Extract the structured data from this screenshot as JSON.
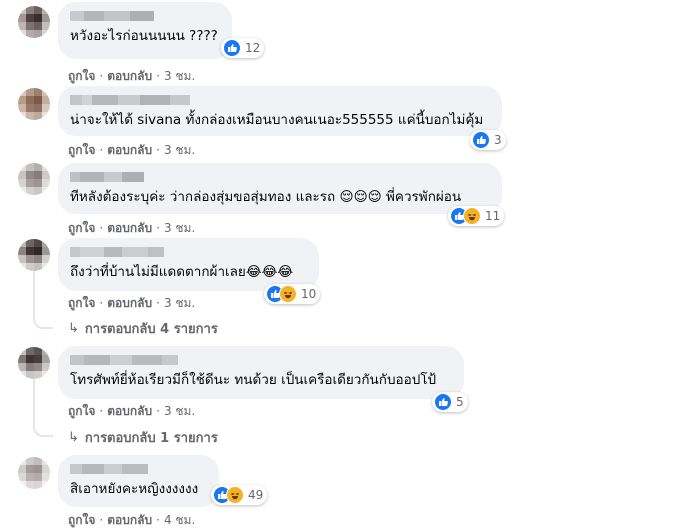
{
  "comments": [
    {
      "text": "หวังอะไรก่อนนนนน ????",
      "reaction_count": "12",
      "reactions": [
        "like-icon"
      ],
      "like_label": "ถูกใจ",
      "reply_label": "ตอบกลับ",
      "time": "3 ชม."
    },
    {
      "text": "น่าจะให้ได้ sivana ทั้งกล่องเหมือนบางคนเนอะ555555 แค่นี้บอกไม่คุ้ม",
      "reaction_count": "3",
      "reactions": [
        "like-icon"
      ],
      "like_label": "ถูกใจ",
      "reply_label": "ตอบกลับ",
      "time": "3 ชม."
    },
    {
      "text": "ทีหลังต้องระบุค่ะ ว่ากล่องสุ่มขอสุ่มทอง และรถ 😌😌😌 พี่ควรพักผ่อน",
      "reaction_count": "11",
      "reactions": [
        "like-icon",
        "haha-icon"
      ],
      "like_label": "ถูกใจ",
      "reply_label": "ตอบกลับ",
      "time": "3 ชม."
    },
    {
      "text": "ถึงว่าที่บ้านไม่มีแดดตากผ้าเลย😂😂😂",
      "reaction_count": "10",
      "reactions": [
        "like-icon",
        "haha-icon"
      ],
      "like_label": "ถูกใจ",
      "reply_label": "ตอบกลับ",
      "time": "3 ชม.",
      "view_replies": "การตอบกลับ 4 รายการ"
    },
    {
      "text": "โทรศัพท์ยี่ห้อเรียวมีก็ใช้ดีนะ ทนด้วย เป็นเครือเดียวกันกับออปโป้",
      "reaction_count": "5",
      "reactions": [
        "like-icon"
      ],
      "like_label": "ถูกใจ",
      "reply_label": "ตอบกลับ",
      "time": "3 ชม.",
      "view_replies": "การตอบกลับ 1 รายการ"
    },
    {
      "text": "สิเอาหยังคะหญิงงงงงง",
      "reaction_count": "49",
      "reactions": [
        "like-icon",
        "haha-icon"
      ],
      "like_label": "ถูกใจ",
      "reply_label": "ตอบกลับ",
      "time": "4 ชม."
    }
  ],
  "colors": {
    "like": "#1877f2",
    "haha": "#f7b125",
    "bubble": "#f0f2f5",
    "meta": "#65676b"
  }
}
